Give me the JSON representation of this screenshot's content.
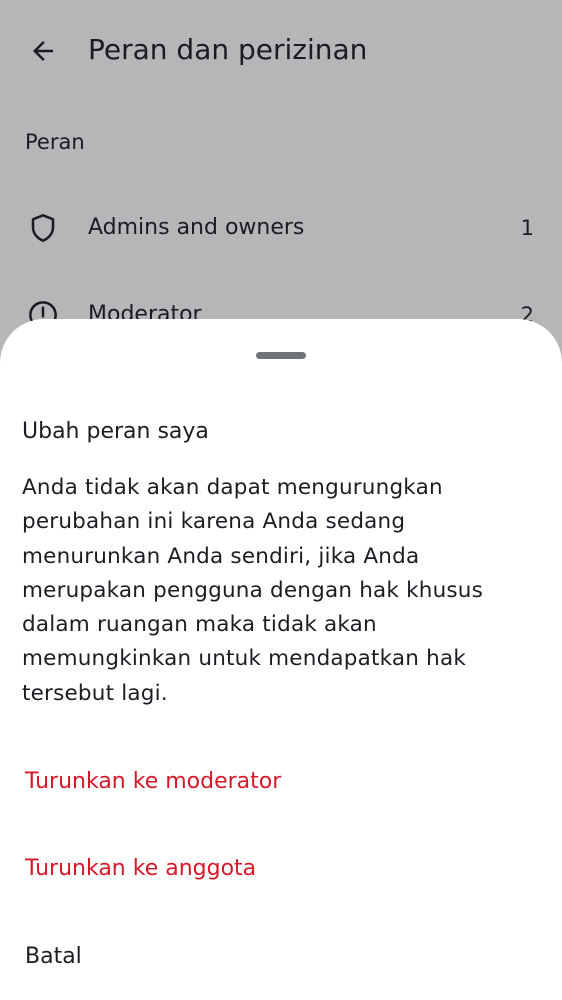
{
  "header": {
    "title": "Peran dan perizinan",
    "back_icon": "arrow-left-icon"
  },
  "roles_section": {
    "header": "Peran",
    "items": [
      {
        "label": "Admins and owners",
        "count": "1",
        "icon": "shield-icon"
      },
      {
        "label": "Moderator",
        "count": "2",
        "icon": "moderator-icon"
      }
    ]
  },
  "sheet": {
    "title": "Ubah peran saya",
    "message": "Anda tidak akan dapat mengurungkan perubahan ini karena Anda sedang menurunkan Anda sendiri, jika Anda merupakan pengguna dengan hak khusus dalam ruangan maka tidak akan memungkinkan untuk mendapatkan hak tersebut lagi.",
    "actions": [
      {
        "label": "Turunkan ke moderator",
        "style": "danger"
      },
      {
        "label": "Turunkan ke anggota",
        "style": "danger"
      },
      {
        "label": "Batal",
        "style": "neutral"
      }
    ]
  },
  "colors": {
    "danger": "#d51928",
    "text": "#1b1d22",
    "scrim": "rgba(27,29,34,0.32)",
    "handle": "#6f737a"
  }
}
